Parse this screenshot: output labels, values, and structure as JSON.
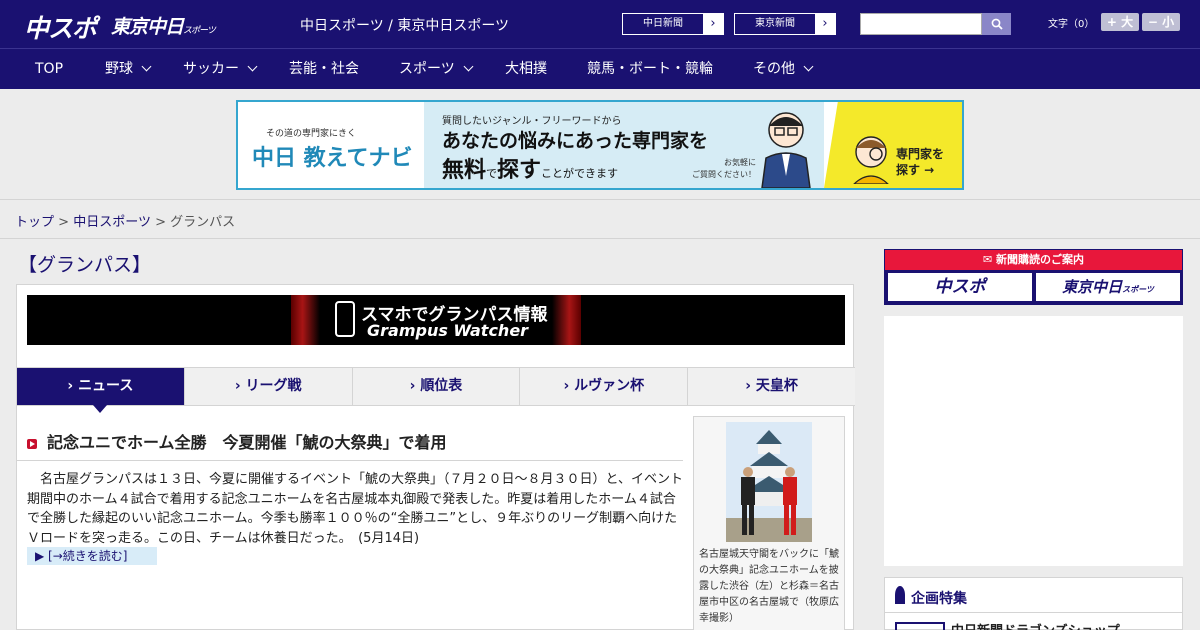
{
  "header": {
    "logo_main": "中スポ",
    "logo_tokyo": "東京中日",
    "logo_tokyo_small": "スポーツ",
    "site_title": "中日スポーツ / 東京中日スポーツ",
    "links": [
      {
        "label": "中日新聞"
      },
      {
        "label": "東京新聞"
      }
    ],
    "search_placeholder": "",
    "font_size_label": "文字（0）",
    "font_bigger": "+ 大",
    "font_smaller": "− 小"
  },
  "nav": {
    "items": [
      {
        "label": "TOP",
        "has_dropdown": false
      },
      {
        "label": "野球",
        "has_dropdown": true
      },
      {
        "label": "サッカー",
        "has_dropdown": true
      },
      {
        "label": "芸能・社会",
        "has_dropdown": false
      },
      {
        "label": "スポーツ",
        "has_dropdown": true
      },
      {
        "label": "大相撲",
        "has_dropdown": false
      },
      {
        "label": "競馬・ボート・競輪",
        "has_dropdown": false
      },
      {
        "label": "その他",
        "has_dropdown": true
      }
    ]
  },
  "ad_banner": {
    "tagline": "その道の専門家にきく",
    "brand": "中日 教えてナビ",
    "line1": "質問したいジャンル・フリーワードから",
    "line2": "あなたの悩みにあった専門家を",
    "line3_a": "無料",
    "line3_b": "で",
    "line3_c": "探す",
    "line3_d": "ことができます",
    "note": "お気軽に\nご質問ください！",
    "cta": "専門家を\n探す →",
    "accent_color": "#35a6cf"
  },
  "breadcrumb": {
    "items": [
      "トップ",
      "中日スポーツ"
    ],
    "current": "グランパス",
    "sep": ">"
  },
  "main": {
    "section_title": "【グランパス】",
    "promo": {
      "title_ja": "スマホでグランパス情報",
      "title_en": "Grampus Watcher"
    },
    "tabs": [
      {
        "label": "ニュース",
        "active": true
      },
      {
        "label": "リーグ戦",
        "active": false
      },
      {
        "label": "順位表",
        "active": false
      },
      {
        "label": "ルヴァン杯",
        "active": false
      },
      {
        "label": "天皇杯",
        "active": false
      }
    ],
    "article": {
      "title": "記念ユニでホーム全勝　今夏開催「鯱の大祭典」で着用",
      "body": "名古屋グランパスは１３日、今夏に開催するイベント「鯱の大祭典」（７月２０日～８月３０日）と、イベント期間中のホーム４試合で着用する記念ユニホームを名古屋城本丸御殿で発表した。昨夏は着用したホーム４試合で全勝した縁起のいい記念ユニホーム。今季も勝率１００％の“全勝ユニ”とし、９年ぶりのリーグ制覇へ向けたＶロードを突っ走る。この日、チームは休養日だった。　(5月14日)",
      "more": "[→続きを読む]",
      "photo_caption": "名古屋城天守閣をバックに「鯱の大祭典」記念ユニホームを披露した渋谷（左）と杉森＝名古屋市中区の名古屋城で（牧原広幸撮影）"
    }
  },
  "sidebar": {
    "subscribe": {
      "title": "新聞購読のご案内",
      "btn1": "中スポ",
      "btn2": "東京中日",
      "btn2_small": "スポーツ"
    },
    "feature": {
      "title": "企画特集",
      "item": "中日新聞ドラゴンズショップ"
    }
  },
  "colors": {
    "brand_navy": "#1a1171",
    "accent_red": "#e8173b"
  }
}
